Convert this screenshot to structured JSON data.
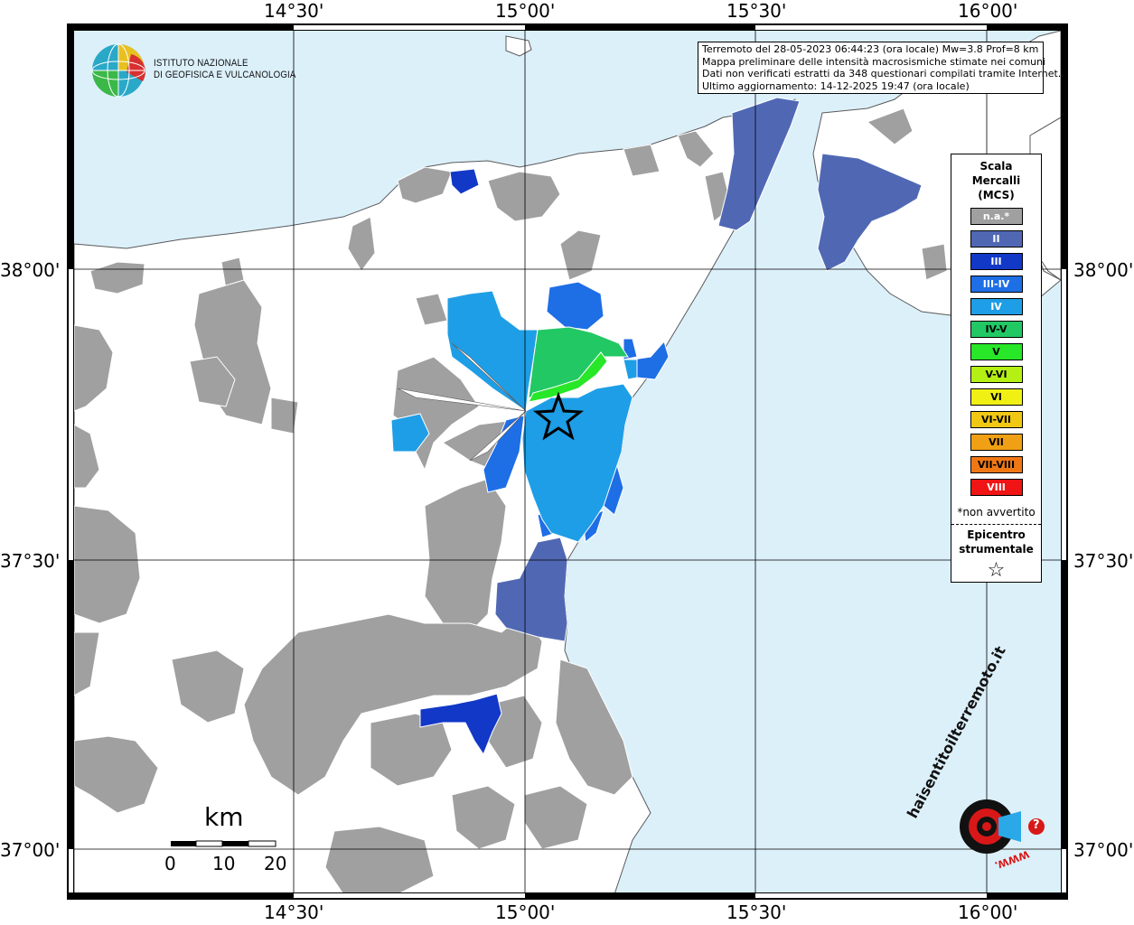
{
  "axes": {
    "lon_top": [
      "14°30'",
      "15°00'",
      "15°30'",
      "16°00'"
    ],
    "lon_bottom": [
      "14°30'",
      "15°00'",
      "15°30'",
      "16°00'"
    ],
    "lat_left": [
      "38°00'",
      "37°30'",
      "37°00'"
    ],
    "lat_right": [
      "38°00'",
      "37°30'",
      "37°00'"
    ]
  },
  "logo": {
    "line1": "ISTITUTO NAZIONALE",
    "line2": "DI GEOFISICA E VULCANOLOGIA"
  },
  "info": {
    "line1": "Terremoto del 28-05-2023 06:44:23 (ora locale) Mw=3.8 Prof=8 km",
    "line2": "Mappa preliminare delle intensità macrosismiche stimate nei comuni",
    "line3": "Dati non verificati estratti da 348 questionari compilati tramite Internet.",
    "line4": "Ultimo aggiornamento: 14-12-2025 19:47 (ora locale)"
  },
  "legend": {
    "title1": "Scala",
    "title2": "Mercalli",
    "title3": "(MCS)",
    "items": [
      {
        "label": "n.a.*",
        "color": "#a0a0a0",
        "text_color": "#ffffff"
      },
      {
        "label": "II",
        "color": "#5068b4",
        "text_color": "#ffffff"
      },
      {
        "label": "III",
        "color": "#1238c8",
        "text_color": "#ffffff"
      },
      {
        "label": "III-IV",
        "color": "#1e6ee6",
        "text_color": "#ffffff"
      },
      {
        "label": "IV",
        "color": "#1e9ee6",
        "text_color": "#ffffff"
      },
      {
        "label": "IV-V",
        "color": "#22c864",
        "text_color": "#000000"
      },
      {
        "label": "V",
        "color": "#28e628",
        "text_color": "#000000"
      },
      {
        "label": "V-VI",
        "color": "#b4f014",
        "text_color": "#000000"
      },
      {
        "label": "VI",
        "color": "#f0f014",
        "text_color": "#000000"
      },
      {
        "label": "VI-VII",
        "color": "#f0c814",
        "text_color": "#000000"
      },
      {
        "label": "VII",
        "color": "#f0a014",
        "text_color": "#000000"
      },
      {
        "label": "VII-VIII",
        "color": "#f07814",
        "text_color": "#000000"
      },
      {
        "label": "VIII",
        "color": "#f01414",
        "text_color": "#ffffff"
      }
    ],
    "note": "*non avvertito",
    "epicenter1": "Epicentro",
    "epicenter2": "strumentale",
    "star": "☆"
  },
  "scalebar": {
    "unit": "km",
    "ticks": [
      "0",
      "10",
      "20"
    ]
  },
  "haisentito": {
    "text": "haisentitoilterremoto.it",
    "url": "WWW.",
    "question": "?"
  },
  "colors": {
    "sea": "#dcf0fa",
    "land_empty": "#ffffff",
    "na_gray": "#a0a0a0",
    "coast": "#5a5a5a",
    "grid": "#000000"
  }
}
